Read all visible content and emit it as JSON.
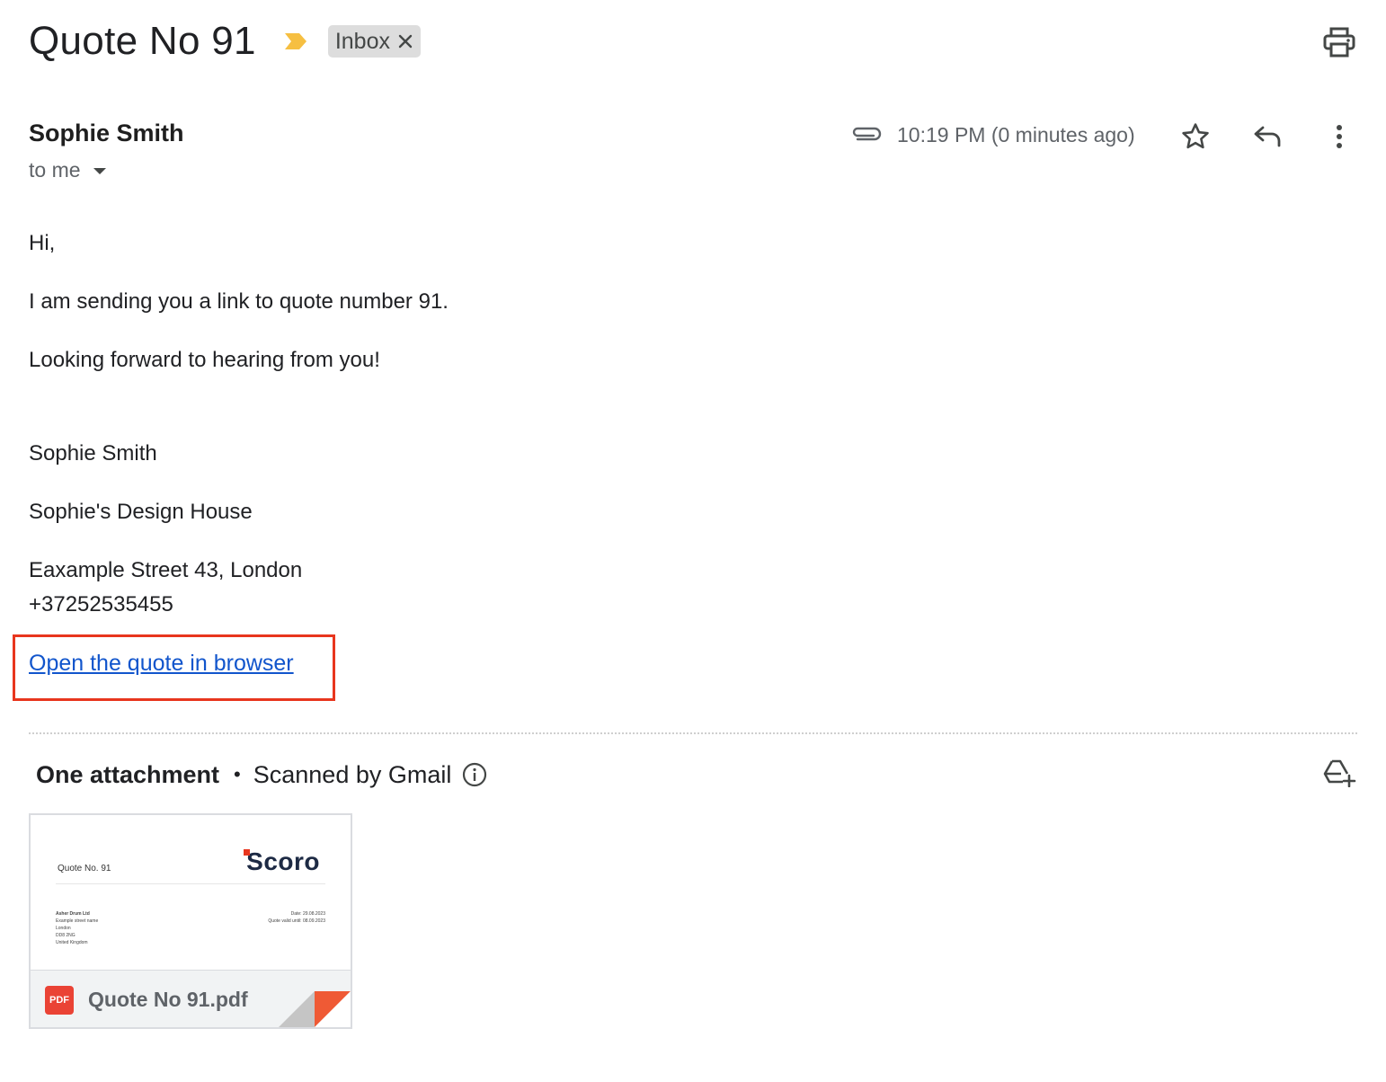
{
  "email": {
    "subject": "Quote No 91",
    "label": "Inbox",
    "sender_name": "Sophie Smith",
    "recipient": "to me",
    "timestamp": "10:19 PM (0 minutes ago)",
    "body": {
      "greeting": "Hi,",
      "line1": "I am sending you a link to quote number 91.",
      "line2": "Looking forward to hearing from you!",
      "signature_name": "Sophie Smith",
      "signature_company": "Sophie's Design House",
      "signature_address": "Eaxample Street 43, London",
      "signature_phone": "+37252535455"
    },
    "link_text": "Open the quote in browser"
  },
  "attachments": {
    "title": "One attachment",
    "separator": "•",
    "scanned": "Scanned by Gmail",
    "file": {
      "name": "Quote No 91.pdf",
      "type_badge": "PDF",
      "preview": {
        "heading": "Quote No. 91",
        "logo": "Scoro",
        "client_lines": [
          "Asher Drum Ltd",
          "Example street name",
          "London",
          "DD8 2NG",
          "United Kingdom"
        ],
        "meta_lines": [
          "Date:  29.08.2023",
          "Quote valid until:  08.09.2023"
        ]
      }
    }
  },
  "colors": {
    "importance_marker": "#f6bf41",
    "link": "#1155cc",
    "highlight_box": "#e8361e",
    "pdf_badge": "#ea4335"
  },
  "icons": {
    "print": "print-icon",
    "attachment": "paperclip-icon",
    "star": "star-icon",
    "reply": "reply-icon",
    "more": "more-vert-icon",
    "info": "info-icon",
    "drive": "add-to-drive-icon"
  }
}
